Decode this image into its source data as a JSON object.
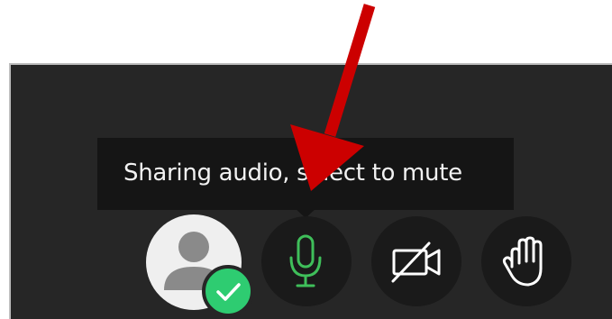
{
  "tooltip": {
    "text": "Sharing audio, select to mute"
  },
  "controls": {
    "avatar_icon": "user-avatar-icon",
    "avatar_status_icon": "checkmark-icon",
    "mic_icon": "microphone-icon",
    "camera_icon": "camera-off-icon",
    "hand_icon": "raise-hand-icon"
  },
  "colors": {
    "panel_bg": "#262626",
    "button_bg": "#1a1a1a",
    "mic_active": "#3fbf5a",
    "status_green": "#2ecc71",
    "annotation_arrow": "#cc0000"
  }
}
